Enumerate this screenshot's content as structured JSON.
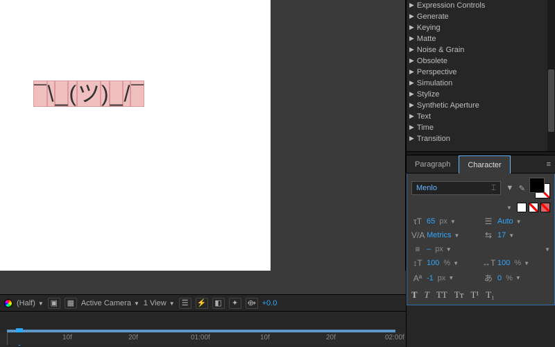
{
  "comp": {
    "text": "¯\\_(ツ)_/¯"
  },
  "viewer": {
    "resolution": "(Half)",
    "camera": "Active Camera",
    "views": "1 View",
    "exposure": "+0.0"
  },
  "timeline": {
    "ticks": [
      "10f",
      "20f",
      "01:00f",
      "10f",
      "20f",
      "02:00f"
    ]
  },
  "effects": {
    "items": [
      "Expression Controls",
      "Generate",
      "Keying",
      "Matte",
      "Noise & Grain",
      "Obsolete",
      "Perspective",
      "Simulation",
      "Stylize",
      "Synthetic Aperture",
      "Text",
      "Time",
      "Transition"
    ]
  },
  "tabs": {
    "paragraph": "Paragraph",
    "character": "Character"
  },
  "char": {
    "font": "Menlo",
    "size": "65",
    "size_unit": "px",
    "leading": "Auto",
    "kerning": "Metrics",
    "tracking": "17",
    "stroke": "–",
    "stroke_unit": "px",
    "vscale": "100",
    "hscale": "100",
    "scale_unit": "%",
    "baseline": "-1",
    "baseline_unit": "px",
    "tsume": "0",
    "tsume_unit": "%",
    "styles": {
      "bold": "T",
      "italic": "T",
      "caps": "TT",
      "smallcaps": "Tᴛ",
      "sup": "T¹",
      "sub": "T₁"
    }
  },
  "colors": {
    "fill": "#000000",
    "stroke": "#ffffff"
  }
}
